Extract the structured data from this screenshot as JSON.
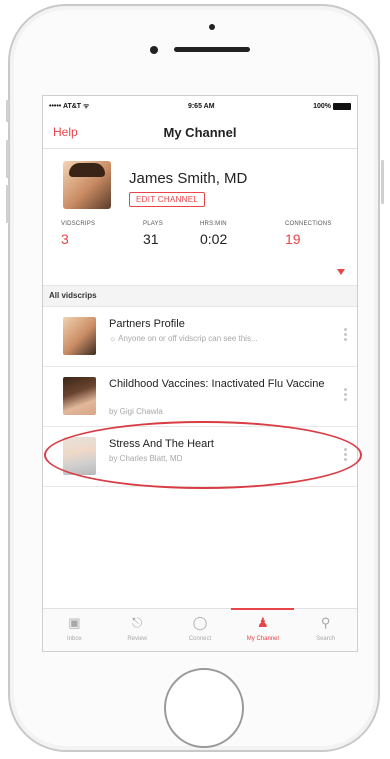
{
  "status_bar": {
    "carrier": "••••• AT&T ᯤ",
    "time": "9:65 AM",
    "battery": "100%"
  },
  "nav": {
    "left": "Help",
    "title": "My Channel"
  },
  "profile": {
    "name": "James Smith, MD",
    "edit_label": "EDIT CHANNEL"
  },
  "stats": [
    {
      "label": "VIDSCRIPS",
      "value": "3"
    },
    {
      "label": "PLAYS",
      "value": "31"
    },
    {
      "label": "HRS:MIN",
      "value": "0:02"
    },
    {
      "label": "CONNECTIONS",
      "value": "19"
    }
  ],
  "colors": {
    "accent": "#e8454a",
    "highlight": "#d93d44"
  },
  "section_header": "All vidscrips",
  "items": [
    {
      "title": "Partners Profile",
      "subtitle": "Anyone on or off vidscrip can see this..."
    },
    {
      "title": "Childhood Vaccines: Inactivated Flu Vaccine",
      "subtitle": "by Gigi Chawla"
    },
    {
      "title": "Stress And The Heart",
      "subtitle": "by Charles Blatt, MD"
    }
  ],
  "tabs": [
    {
      "label": "Inbox",
      "icon": "inbox-icon"
    },
    {
      "label": "Review",
      "icon": "microphone-icon"
    },
    {
      "label": "Connect",
      "icon": "connect-icon"
    },
    {
      "label": "My Channel",
      "icon": "person-icon"
    },
    {
      "label": "Search",
      "icon": "search-icon"
    }
  ]
}
